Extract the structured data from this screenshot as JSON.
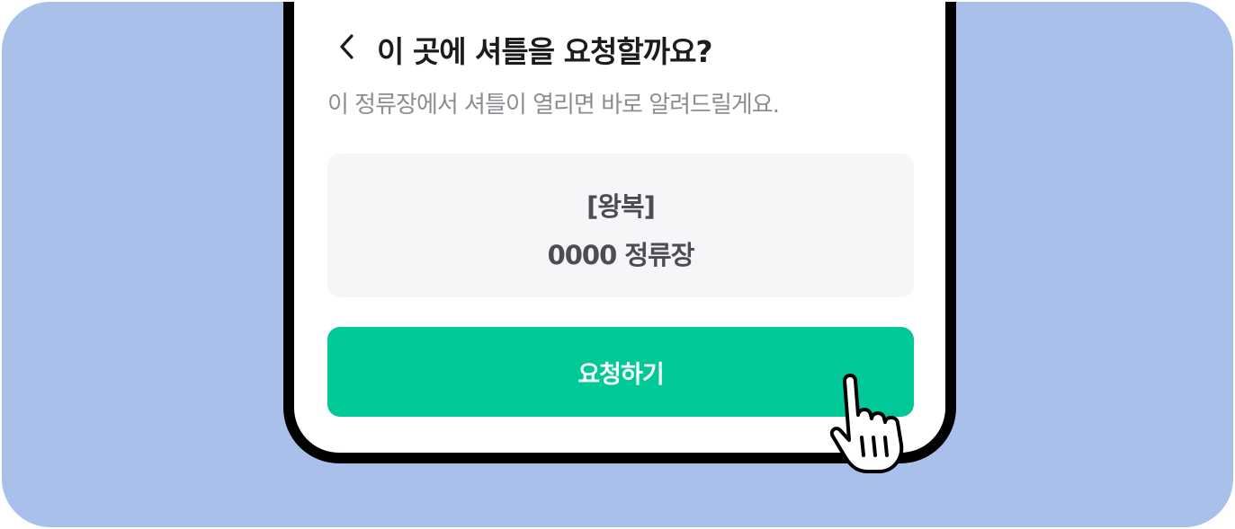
{
  "sheet": {
    "title": "이 곳에 셔틀을 요청할까요?",
    "subtitle": "이 정류장에서 셔틀이 열리면 바로 알려드릴게요."
  },
  "stop_card": {
    "route_type": "[왕복]",
    "stop_name": "0000 정류장"
  },
  "actions": {
    "request_label": "요청하기"
  },
  "icons": {
    "back": "chevron-left-icon",
    "cursor": "hand-pointer-icon"
  },
  "colors": {
    "background": "#a9c1ea",
    "primary": "#00c896",
    "card": "#f5f6f8",
    "title": "#1c1c1e",
    "subtitle": "#8a8d92"
  }
}
